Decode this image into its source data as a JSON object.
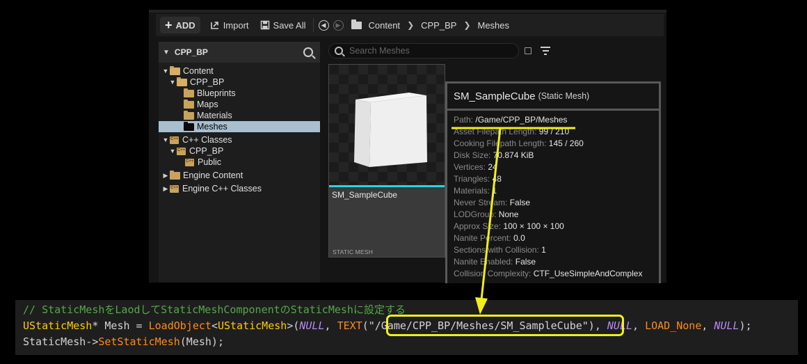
{
  "toolbar": {
    "add_label": "ADD",
    "import_label": "Import",
    "save_all_label": "Save All",
    "breadcrumbs": [
      "Content",
      "CPP_BP",
      "Meshes"
    ]
  },
  "tree": {
    "header": "CPP_BP",
    "items": [
      {
        "label": "Content"
      },
      {
        "label": "CPP_BP"
      },
      {
        "label": "Blueprints"
      },
      {
        "label": "Maps"
      },
      {
        "label": "Materials"
      },
      {
        "label": "Meshes"
      },
      {
        "label": "C++ Classes"
      },
      {
        "label": "CPP_BP"
      },
      {
        "label": "Public"
      },
      {
        "label": "Engine Content"
      },
      {
        "label": "Engine C++ Classes"
      }
    ]
  },
  "assets": {
    "search_placeholder": "Search Meshes",
    "tile": {
      "name": "SM_SampleCube",
      "type": "STATIC MESH",
      "accent_color": "#2ad1e6"
    }
  },
  "tooltip": {
    "title": "SM_SampleCube",
    "subtitle": "(Static Mesh)",
    "properties": [
      {
        "key": "Path:",
        "value": "/Game/CPP_BP/Meshes"
      },
      {
        "key": "Asset Filepath Length:",
        "value": "99 / 210"
      },
      {
        "key": "Cooking Filepath Length:",
        "value": "145 / 260"
      },
      {
        "key": "Disk Size:",
        "value": "70.874 KiB"
      },
      {
        "key": "Vertices:",
        "value": "24"
      },
      {
        "key": "Triangles:",
        "value": "48"
      },
      {
        "key": "Materials:",
        "value": "1"
      },
      {
        "key": "Never Stream:",
        "value": "False"
      },
      {
        "key": "LODGroup:",
        "value": "None"
      },
      {
        "key": "Approx Size:",
        "value": "100 × 100 × 100"
      },
      {
        "key": "Nanite Percent:",
        "value": "0.0"
      },
      {
        "key": "Sections with Collision:",
        "value": "1"
      },
      {
        "key": "Nanite Enabled:",
        "value": "False"
      },
      {
        "key": "Collision Complexity:",
        "value": "CTF_UseSimpleAndComplex"
      }
    ]
  },
  "code": {
    "comment": "// StaticMeshをLaodしてStaticMeshComponentのStaticMeshに設定する",
    "line2": {
      "type": "UStaticMesh",
      "star": "*",
      "var": " Mesh = ",
      "func": "LoadObject",
      "lt": "<",
      "tmpl": "UStaticMesh",
      "gt_paren": ">(",
      "null1": "NULL",
      "comma1": ", ",
      "text_macro": "TEXT",
      "open": "(",
      "str": "\"/Game/CPP_BP/Meshes/SM_SampleCube\"",
      "close": ")",
      "comma2": ", ",
      "null2": "NULL",
      "comma3": ", ",
      "load_none": "LOAD_None",
      "comma4": ", ",
      "null3": "NULL",
      "end": ");"
    },
    "line3": {
      "obj": "StaticMesh->",
      "func": "SetStaticMesh",
      "args": "(Mesh);"
    }
  },
  "colors": {
    "highlight": "#f1ef1a",
    "selection": "#a9bfd0"
  }
}
